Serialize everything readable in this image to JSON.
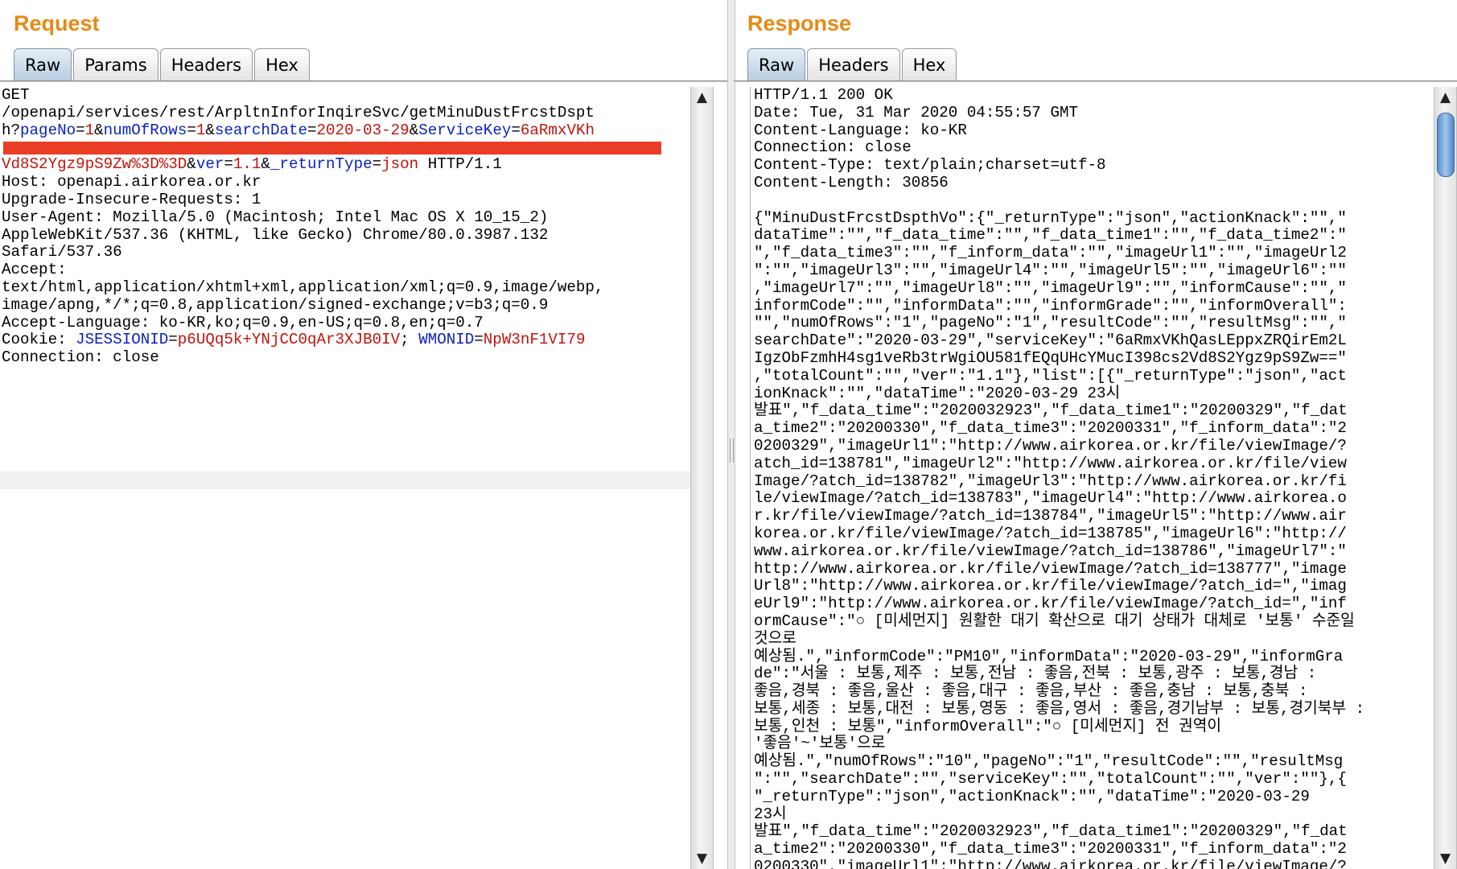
{
  "request": {
    "title": "Request",
    "tabs": [
      "Raw",
      "Params",
      "Headers",
      "Hex"
    ],
    "active_tab": "Raw",
    "lines": {
      "l1": "GET",
      "l2": "/openapi/services/rest/ArpltnInforInqireSvc/getMinuDustFrcstDspt",
      "l3_prefix": "h?",
      "p_pageNo_k": "pageNo",
      "p_pageNo_v": "1",
      "p_numOfRows_k": "numOfRows",
      "p_numOfRows_v": "1",
      "p_searchDate_k": "searchDate",
      "p_searchDate_v": "2020-03-29",
      "p_ServiceKey_k": "ServiceKey",
      "p_ServiceKey_v1": "6aRmxVKh",
      "p_ServiceKey_v2": "Vd8S2Ygz9pS9Zw%3D%3D",
      "p_ver_k": "ver",
      "p_ver_v": "1.1",
      "p_returnType_k": "_returnType",
      "p_returnType_v": "json",
      "http_version": " HTTP/1.1",
      "host": "Host: openapi.airkorea.or.kr",
      "upgrade": "Upgrade-Insecure-Requests: 1",
      "ua1": "User-Agent: Mozilla/5.0 (Macintosh; Intel Mac OS X 10_15_2)",
      "ua2": "AppleWebKit/537.36 (KHTML, like Gecko) Chrome/80.0.3987.132",
      "ua3": "Safari/537.36",
      "accept": "Accept:",
      "accept1": "text/html,application/xhtml+xml,application/xml;q=0.9,image/webp,",
      "accept2": "image/apng,*/*;q=0.8,application/signed-exchange;v=b3;q=0.9",
      "accept_lang": "Accept-Language: ko-KR,ko;q=0.9,en-US;q=0.8,en;q=0.7",
      "cookie_label": "Cookie: ",
      "cookie_jsess_k": "JSESSIONID",
      "cookie_jsess_v": "p6UQq5k+YNjCC0qAr3XJB0IV",
      "cookie_sep": "; ",
      "cookie_wmon_k": "WMONID",
      "cookie_wmon_v": "NpW3nF1VI79",
      "connection": "Connection: close"
    }
  },
  "response": {
    "title": "Response",
    "tabs": [
      "Raw",
      "Headers",
      "Hex"
    ],
    "active_tab": "Raw",
    "lines": [
      "HTTP/1.1 200 OK",
      "Date: Tue, 31 Mar 2020 04:55:57 GMT",
      "Content-Language: ko-KR",
      "Connection: close",
      "Content-Type: text/plain;charset=utf-8",
      "Content-Length: 30856",
      "",
      "{\"MinuDustFrcstDspthVo\":{\"_returnType\":\"json\",\"actionKnack\":\"\",\"",
      "dataTime\":\"\",\"f_data_time\":\"\",\"f_data_time1\":\"\",\"f_data_time2\":\"",
      "\",\"f_data_time3\":\"\",\"f_inform_data\":\"\",\"imageUrl1\":\"\",\"imageUrl2",
      "\":\"\",\"imageUrl3\":\"\",\"imageUrl4\":\"\",\"imageUrl5\":\"\",\"imageUrl6\":\"\"",
      ",\"imageUrl7\":\"\",\"imageUrl8\":\"\",\"imageUrl9\":\"\",\"informCause\":\"\",\"",
      "informCode\":\"\",\"informData\":\"\",\"informGrade\":\"\",\"informOverall\":",
      "\"\",\"numOfRows\":\"1\",\"pageNo\":\"1\",\"resultCode\":\"\",\"resultMsg\":\"\",\"",
      "searchDate\":\"2020-03-29\",\"serviceKey\":\"6aRmxVKhQasLEppxZRQirEm2L",
      "IgzObFzmhH4sg1veRb3trWgiOU581fEQqUHcYMucI398cs2Vd8S2Ygz9pS9Zw==\"",
      ",\"totalCount\":\"\",\"ver\":\"1.1\"},\"list\":[{\"_returnType\":\"json\",\"act",
      "ionKnack\":\"\",\"dataTime\":\"2020-03-29 23시",
      "발표\",\"f_data_time\":\"2020032923\",\"f_data_time1\":\"20200329\",\"f_dat",
      "a_time2\":\"20200330\",\"f_data_time3\":\"20200331\",\"f_inform_data\":\"2",
      "0200329\",\"imageUrl1\":\"http://www.airkorea.or.kr/file/viewImage/?",
      "atch_id=138781\",\"imageUrl2\":\"http://www.airkorea.or.kr/file/view",
      "Image/?atch_id=138782\",\"imageUrl3\":\"http://www.airkorea.or.kr/fi",
      "le/viewImage/?atch_id=138783\",\"imageUrl4\":\"http://www.airkorea.o",
      "r.kr/file/viewImage/?atch_id=138784\",\"imageUrl5\":\"http://www.air",
      "korea.or.kr/file/viewImage/?atch_id=138785\",\"imageUrl6\":\"http://",
      "www.airkorea.or.kr/file/viewImage/?atch_id=138786\",\"imageUrl7\":\"",
      "http://www.airkorea.or.kr/file/viewImage/?atch_id=138777\",\"image",
      "Url8\":\"http://www.airkorea.or.kr/file/viewImage/?atch_id=\",\"imag",
      "eUrl9\":\"http://www.airkorea.or.kr/file/viewImage/?atch_id=\",\"inf",
      "ormCause\":\"○ [미세먼지] 원활한 대기 확산으로 대기 상태가 대체로 '보통' 수준일",
      "것으로",
      "예상됨.\",\"informCode\":\"PM10\",\"informData\":\"2020-03-29\",\"informGra",
      "de\":\"서울 : 보통,제주 : 보통,전남 : 좋음,전북 : 보통,광주 : 보통,경남 :",
      "좋음,경북 : 좋음,울산 : 좋음,대구 : 좋음,부산 : 좋음,충남 : 보통,충북 :",
      "보통,세종 : 보통,대전 : 보통,영동 : 좋음,영서 : 좋음,경기남부 : 보통,경기북부 :",
      "보통,인천 : 보통\",\"informOverall\":\"○ [미세먼지] 전 권역이",
      "'좋음'~'보통'으로",
      "예상됨.\",\"numOfRows\":\"10\",\"pageNo\":\"1\",\"resultCode\":\"\",\"resultMsg",
      "\":\"\",\"searchDate\":\"\",\"serviceKey\":\"\",\"totalCount\":\"\",\"ver\":\"\"},{",
      "\"_returnType\":\"json\",\"actionKnack\":\"\",\"dataTime\":\"2020-03-29",
      "23시",
      "발표\",\"f_data_time\":\"2020032923\",\"f_data_time1\":\"20200329\",\"f_dat",
      "a_time2\":\"20200330\",\"f_data_time3\":\"20200331\",\"f_inform_data\":\"2",
      "0200330\",\"imageUrl1\":\"http://www.airkorea.or.kr/file/viewImage/?"
    ]
  },
  "colors": {
    "title": "#e58a15",
    "param_key": "#0a1fc4",
    "param_value": "#c2130d",
    "redaction": "#ea3d26",
    "scroll_thumb": "#6a9bd1"
  }
}
